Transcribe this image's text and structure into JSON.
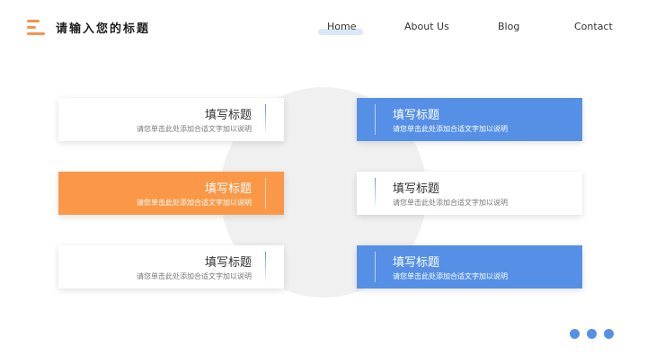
{
  "header": {
    "title": "请输入您的标题",
    "menu_icon": "menu-icon",
    "nav": [
      "Home",
      "About Us",
      "Blog",
      "Contact"
    ],
    "active_nav": "Home"
  },
  "colors": {
    "accent_orange": "#fb9848",
    "accent_blue": "#5690e6",
    "circle": "#f0f0f0"
  },
  "cards": [
    {
      "title": "填写标题",
      "desc": "请您单击此处添加合适文字加以说明"
    },
    {
      "title": "填写标题",
      "desc": "请您单击此处添加合适文字加以说明"
    },
    {
      "title": "填写标题",
      "desc": "请您单击此处添加合适文字加以说明"
    },
    {
      "title": "填写标题",
      "desc": "请您单击此处添加合适文字加以说明"
    },
    {
      "title": "填写标题",
      "desc": "请您单击此处添加合适文字加以说明"
    },
    {
      "title": "填写标题",
      "desc": "请您单击此处添加合适文字加以说明"
    }
  ],
  "pagination": {
    "dots": 3
  }
}
